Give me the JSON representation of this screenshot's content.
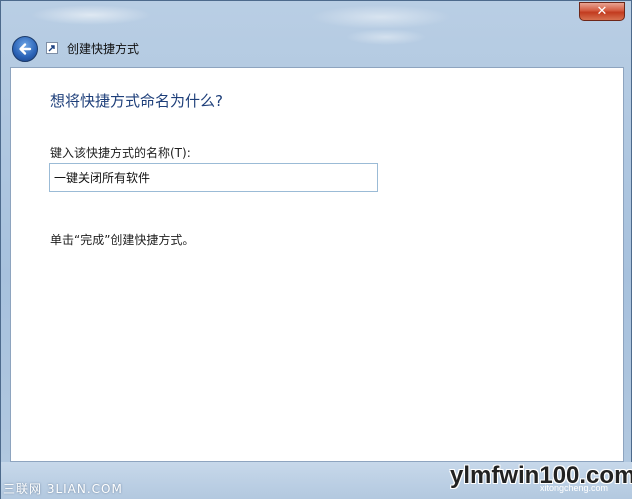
{
  "window": {
    "title": "创建快捷方式",
    "close_glyph": "✕"
  },
  "page": {
    "heading": "想将快捷方式命名为什么?",
    "name_label": "键入该快捷方式的名称(T):",
    "name_value": "一键关闭所有软件",
    "finish_hint": "单击“完成”创建快捷方式。"
  },
  "watermark": {
    "left_text": "三联网 3LIAN.COM",
    "right_text": "ylmfwin100.com",
    "right_sub": "xitongcheng.com"
  },
  "colors": {
    "heading": "#1e3f7a",
    "close_red": "#c23b1f",
    "frame": "#a7c1dd"
  },
  "icons": {
    "back": "back-arrow-icon",
    "shortcut": "shortcut-icon",
    "close": "close-icon"
  }
}
